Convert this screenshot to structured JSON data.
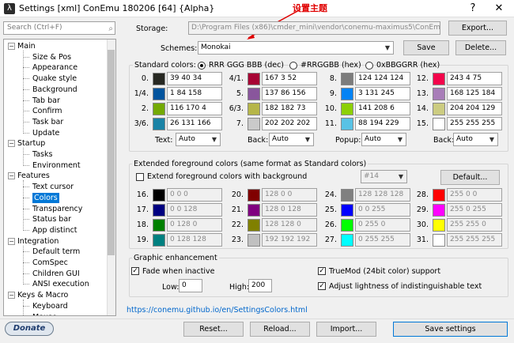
{
  "window": {
    "title": "Settings [xml] ConEmu 180206 [64] {Alpha}",
    "help": "?",
    "close": "✕",
    "annotation": "设置主题"
  },
  "search": {
    "placeholder": "Search (Ctrl+F)"
  },
  "tree": [
    {
      "label": "Main",
      "level": 0,
      "expanded": true
    },
    {
      "label": "Size & Pos",
      "level": 1
    },
    {
      "label": "Appearance",
      "level": 1
    },
    {
      "label": "Quake style",
      "level": 1
    },
    {
      "label": "Background",
      "level": 1
    },
    {
      "label": "Tab bar",
      "level": 1
    },
    {
      "label": "Confirm",
      "level": 1
    },
    {
      "label": "Task bar",
      "level": 1
    },
    {
      "label": "Update",
      "level": 1
    },
    {
      "label": "Startup",
      "level": 0,
      "expanded": true
    },
    {
      "label": "Tasks",
      "level": 1
    },
    {
      "label": "Environment",
      "level": 1
    },
    {
      "label": "Features",
      "level": 0,
      "expanded": true
    },
    {
      "label": "Text cursor",
      "level": 1
    },
    {
      "label": "Colors",
      "level": 1,
      "selected": true
    },
    {
      "label": "Transparency",
      "level": 1
    },
    {
      "label": "Status bar",
      "level": 1
    },
    {
      "label": "App distinct",
      "level": 1
    },
    {
      "label": "Integration",
      "level": 0,
      "expanded": true
    },
    {
      "label": "Default term",
      "level": 1
    },
    {
      "label": "ComSpec",
      "level": 1
    },
    {
      "label": "Children GUI",
      "level": 1
    },
    {
      "label": "ANSI execution",
      "level": 1
    },
    {
      "label": "Keys & Macro",
      "level": 0,
      "expanded": true
    },
    {
      "label": "Keyboard",
      "level": 1
    },
    {
      "label": "Mouse",
      "level": 1
    }
  ],
  "storage": {
    "label": "Storage:",
    "value": "D:\\Program Files (x86)\\cmder_mini\\vendor\\conemu-maximus5\\ConEmu.xml",
    "export": "Export..."
  },
  "schemes": {
    "label": "Schemes:",
    "value": "Monokai",
    "save": "Save",
    "delete": "Delete..."
  },
  "standard": {
    "label": "Standard colors:",
    "radio1": "RRR GGG BBB (dec)",
    "radio2": "#RRGGBB (hex)",
    "radio3": "0xBBGGRR (hex)",
    "colors": [
      {
        "num": "0.",
        "value": "39 40 34",
        "color": "#272822"
      },
      {
        "num": "1/4.",
        "value": "1 84 158",
        "color": "#01549e"
      },
      {
        "num": "2.",
        "value": "116 170 4",
        "color": "#74aa04"
      },
      {
        "num": "3/6.",
        "value": "26 131 166",
        "color": "#1a83a6"
      },
      {
        "num": "4/1.",
        "value": "167 3 52",
        "color": "#a70334"
      },
      {
        "num": "5.",
        "value": "137 86 156",
        "color": "#89569c"
      },
      {
        "num": "6/3.",
        "value": "182 182 73",
        "color": "#b6b649"
      },
      {
        "num": "7.",
        "value": "202 202 202",
        "color": "#cacaca"
      },
      {
        "num": "8.",
        "value": "124 124 124",
        "color": "#7c7c7c"
      },
      {
        "num": "9.",
        "value": "3 131 245",
        "color": "#0383f5"
      },
      {
        "num": "10.",
        "value": "141 208 6",
        "color": "#8dd006"
      },
      {
        "num": "11.",
        "value": "88 194 229",
        "color": "#58c2e5"
      },
      {
        "num": "12.",
        "value": "243 4 75",
        "color": "#f3044b"
      },
      {
        "num": "13.",
        "value": "168 125 184",
        "color": "#a87db8"
      },
      {
        "num": "14.",
        "value": "204 204 129",
        "color": "#cccc81"
      },
      {
        "num": "15.",
        "value": "255 255 255",
        "color": "#ffffff"
      }
    ],
    "text_label": "Text:",
    "text_value": "Auto",
    "back_label": "Back:",
    "back_value": "Auto",
    "popup_label": "Popup:",
    "popup_value": "Auto",
    "back2_label": "Back:",
    "back2_value": "Auto"
  },
  "extended": {
    "label": "Extended foreground colors (same format as Standard colors)",
    "checkbox": "Extend foreground colors with background",
    "select": "#14",
    "default": "Default...",
    "colors": [
      {
        "num": "16.",
        "value": "0 0 0",
        "color": "#000000"
      },
      {
        "num": "17.",
        "value": "0 0 128",
        "color": "#000080"
      },
      {
        "num": "18.",
        "value": "0 128 0",
        "color": "#008000"
      },
      {
        "num": "19.",
        "value": "0 128 128",
        "color": "#008080"
      },
      {
        "num": "20.",
        "value": "128 0 0",
        "color": "#800000"
      },
      {
        "num": "21.",
        "value": "128 0 128",
        "color": "#800080"
      },
      {
        "num": "22.",
        "value": "128 128 0",
        "color": "#808000"
      },
      {
        "num": "23.",
        "value": "192 192 192",
        "color": "#c0c0c0"
      },
      {
        "num": "24.",
        "value": "128 128 128",
        "color": "#808080"
      },
      {
        "num": "25.",
        "value": "0 0 255",
        "color": "#0000ff"
      },
      {
        "num": "26.",
        "value": "0 255 0",
        "color": "#00ff00"
      },
      {
        "num": "27.",
        "value": "0 255 255",
        "color": "#00ffff"
      },
      {
        "num": "28.",
        "value": "255 0 0",
        "color": "#ff0000"
      },
      {
        "num": "29.",
        "value": "255 0 255",
        "color": "#ff00ff"
      },
      {
        "num": "30.",
        "value": "255 255 0",
        "color": "#ffff00"
      },
      {
        "num": "31.",
        "value": "255 255 255",
        "color": "#ffffff"
      }
    ]
  },
  "graphic": {
    "label": "Graphic enhancement",
    "fade": "Fade when inactive",
    "low_label": "Low:",
    "low_value": "0",
    "high_label": "High:",
    "high_value": "200",
    "truemod": "TrueMod (24bit color) support",
    "adjust": "Adjust lightness of indistinguishable text"
  },
  "link": "https://conemu.github.io/en/SettingsColors.html",
  "footer": {
    "donate": "Donate",
    "reset": "Reset...",
    "reload": "Reload...",
    "import": "Import...",
    "save": "Save settings"
  }
}
